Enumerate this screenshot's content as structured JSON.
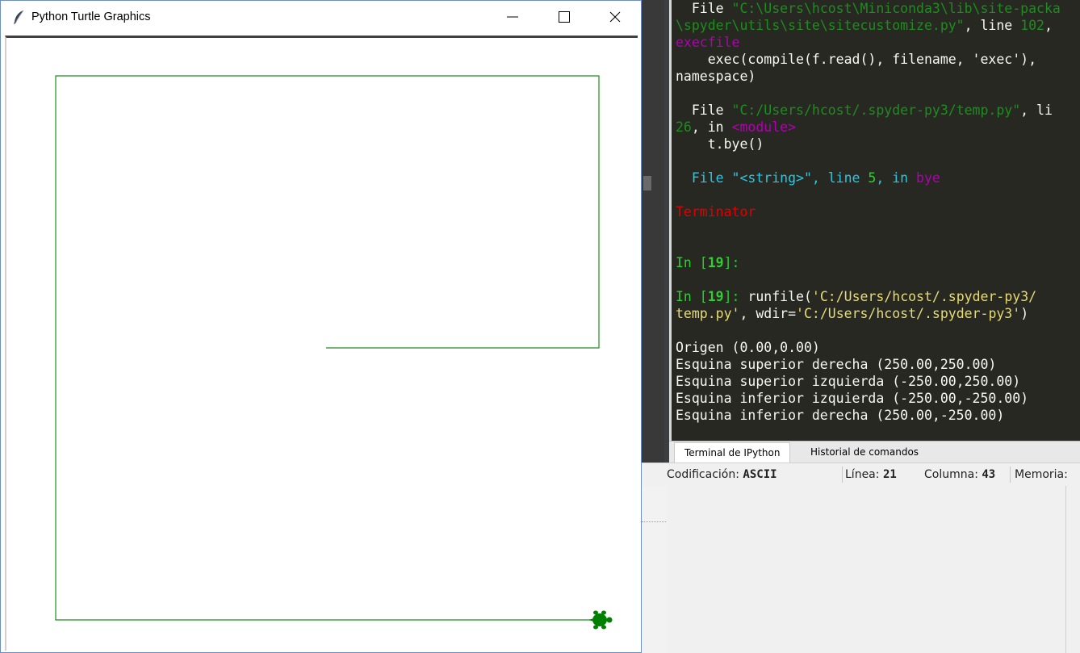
{
  "turtle_window": {
    "title": "Python Turtle Graphics",
    "controls": {
      "minimize": "minimize",
      "maximize": "maximize",
      "close": "close"
    },
    "drawing": {
      "line_color": "#1e8c1e",
      "turtle_color": "#008000"
    }
  },
  "console": {
    "lines": [
      [
        {
          "t": "  File ",
          "c": "white"
        },
        {
          "t": "\"C:\\Users\\hcost\\Miniconda3\\lib\\site-packa",
          "c": "green"
        }
      ],
      [
        {
          "t": "\\spyder\\utils\\site\\sitecustomize.py\"",
          "c": "green"
        },
        {
          "t": ", line ",
          "c": "white"
        },
        {
          "t": "102",
          "c": "green"
        },
        {
          "t": ",",
          "c": "white"
        }
      ],
      [
        {
          "t": "execfile",
          "c": "magenta"
        }
      ],
      [
        {
          "t": "    exec(compile(f.read(), filename, 'exec'),",
          "c": "white"
        }
      ],
      [
        {
          "t": "namespace)",
          "c": "white"
        }
      ],
      [
        {
          "t": "",
          "c": "white"
        }
      ],
      [
        {
          "t": "  File ",
          "c": "white"
        },
        {
          "t": "\"C:/Users/hcost/.spyder-py3/temp.py\"",
          "c": "green"
        },
        {
          "t": ", li",
          "c": "white"
        }
      ],
      [
        {
          "t": "26",
          "c": "green"
        },
        {
          "t": ", in ",
          "c": "white"
        },
        {
          "t": "<module>",
          "c": "magenta"
        }
      ],
      [
        {
          "t": "    t.bye()",
          "c": "white"
        }
      ],
      [
        {
          "t": "",
          "c": "white"
        }
      ],
      [
        {
          "t": "  File \"<string>\", line ",
          "c": "cyan"
        },
        {
          "t": "5",
          "c": "lgreen"
        },
        {
          "t": ", in ",
          "c": "cyan"
        },
        {
          "t": "bye",
          "c": "magenta"
        }
      ],
      [
        {
          "t": "",
          "c": "white"
        }
      ],
      [
        {
          "t": "Terminator",
          "c": "red"
        }
      ],
      [
        {
          "t": "",
          "c": "white"
        }
      ],
      [
        {
          "t": "",
          "c": "white"
        }
      ],
      [
        {
          "t": "In [",
          "c": "lgreen"
        },
        {
          "t": "19",
          "c": "lgreen",
          "b": true
        },
        {
          "t": "]:",
          "c": "lgreen"
        }
      ],
      [
        {
          "t": "",
          "c": "white"
        }
      ],
      [
        {
          "t": "In [",
          "c": "lgreen"
        },
        {
          "t": "19",
          "c": "lgreen",
          "b": true
        },
        {
          "t": "]: ",
          "c": "lgreen"
        },
        {
          "t": "runfile(",
          "c": "white"
        },
        {
          "t": "'C:/Users/hcost/.spyder-py3/",
          "c": "yellow"
        }
      ],
      [
        {
          "t": "temp.py'",
          "c": "yellow"
        },
        {
          "t": ", wdir=",
          "c": "white"
        },
        {
          "t": "'C:/Users/hcost/.spyder-py3'",
          "c": "yellow"
        },
        {
          "t": ")",
          "c": "white"
        }
      ],
      [
        {
          "t": "",
          "c": "white"
        }
      ],
      [
        {
          "t": "Origen (0.00,0.00)",
          "c": "white"
        }
      ],
      [
        {
          "t": "Esquina superior derecha (250.00,250.00)",
          "c": "white"
        }
      ],
      [
        {
          "t": "Esquina superior izquierda (-250.00,250.00)",
          "c": "white"
        }
      ],
      [
        {
          "t": "Esquina inferior izquierda (-250.00,-250.00)",
          "c": "white"
        }
      ],
      [
        {
          "t": "Esquina inferior derecha (250.00,-250.00)",
          "c": "white"
        }
      ]
    ],
    "tabs": [
      "Terminal de IPython",
      "Historial de comandos"
    ]
  },
  "statusbar": {
    "encoding_label": "Codificación:",
    "encoding_value": "ASCII",
    "line_label": "Línea:",
    "line_value": "21",
    "column_label": "Columna:",
    "column_value": "43",
    "memory_label": "Memoria:"
  }
}
